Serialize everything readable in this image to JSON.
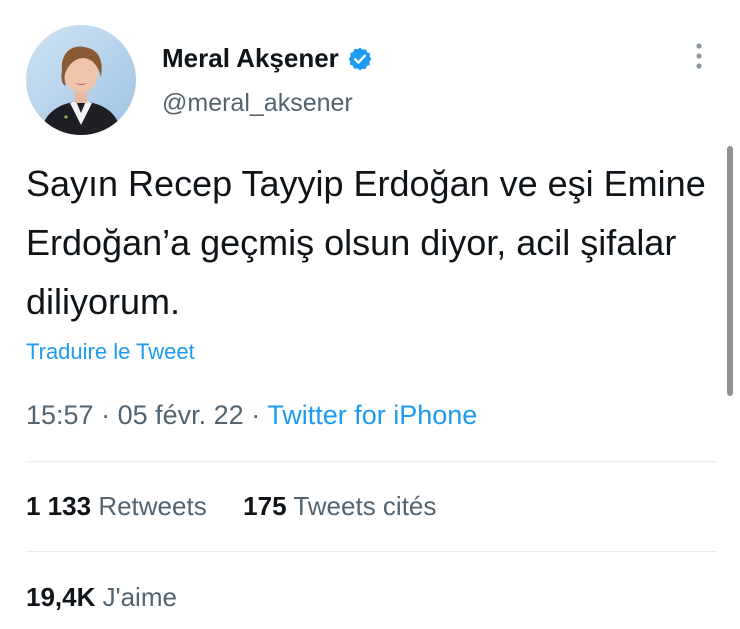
{
  "user": {
    "name": "Meral Akşener",
    "handle": "@meral_aksener",
    "verified_color": "#1d9bf0"
  },
  "tweet": {
    "text": "Sayın Recep Tayyip Erdoğan ve eşi Emine Erdoğan’a geçmiş olsun diyor, acil şifalar diliyorum.",
    "translate_label": "Traduire le Tweet",
    "time": "15:57",
    "date": "05 févr. 22",
    "source": "Twitter for iPhone"
  },
  "stats": {
    "retweets_count": "1 133",
    "retweets_label": "Retweets",
    "quotes_count": "175",
    "quotes_label": "Tweets cités",
    "likes_count": "19,4K",
    "likes_label": "J'aime"
  },
  "icons": {
    "more": "more-vertical-icon",
    "verified": "verified-badge-icon"
  },
  "colors": {
    "accent": "#1d9bf0",
    "text": "#0f1419",
    "secondary": "#536471"
  }
}
